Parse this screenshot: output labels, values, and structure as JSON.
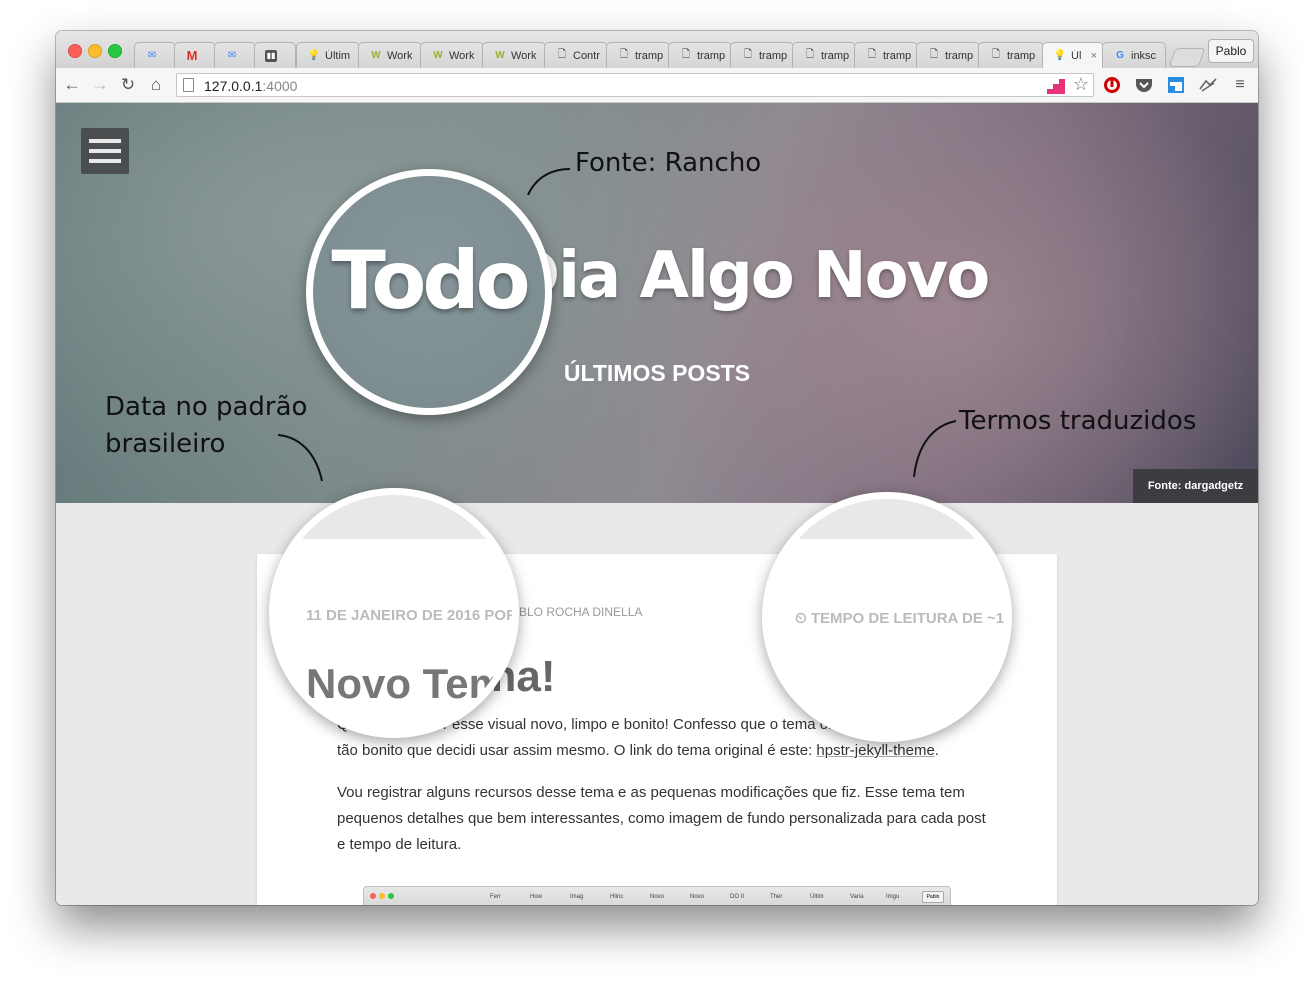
{
  "browser": {
    "tabs": [
      {
        "title": "",
        "icon": "inbox-icon"
      },
      {
        "title": "",
        "icon": "gmail-icon"
      },
      {
        "title": "",
        "icon": "inbox-icon"
      },
      {
        "title": "",
        "icon": "trello-icon"
      },
      {
        "title": "Últim",
        "icon": "bulb-icon"
      },
      {
        "title": "Work",
        "icon": "workflowy-icon"
      },
      {
        "title": "Work",
        "icon": "workflowy-icon"
      },
      {
        "title": "Work",
        "icon": "workflowy-icon"
      },
      {
        "title": "Contr",
        "icon": "page-icon"
      },
      {
        "title": "tramp",
        "icon": "page-icon"
      },
      {
        "title": "tramp",
        "icon": "page-icon"
      },
      {
        "title": "tramp",
        "icon": "page-icon"
      },
      {
        "title": "tramp",
        "icon": "page-icon"
      },
      {
        "title": "tramp",
        "icon": "page-icon"
      },
      {
        "title": "tramp",
        "icon": "page-icon"
      },
      {
        "title": "tramp",
        "icon": "page-icon"
      },
      {
        "title": "Úl",
        "icon": "bulb-icon",
        "active": true,
        "close": "×"
      },
      {
        "title": "inksc",
        "icon": "google-icon"
      }
    ],
    "profile_name": "Pablo",
    "url_host": "127.0.0.1",
    "url_port": ":4000"
  },
  "hero": {
    "title": "Todo Dia Algo Novo",
    "magnified_word": "Todo",
    "subtitle": "ÚLTIMOS POSTS",
    "credit": "Fonte: dargadgetz"
  },
  "annotations": {
    "font": "Fonte: Rancho",
    "date_line1": "Data no padrão",
    "date_line2": "brasileiro",
    "terms": "Termos traduzidos"
  },
  "post": {
    "date": "11 DE JANEIRO DE 2016 POR",
    "author": "BLO ROCHA DINELLA",
    "reading_time": "⏲ TEMPO DE LEITURA DE ~1",
    "title": "Novo Tema!",
    "title_magnified": "Novo Tem",
    "p1_start": "Quem está a ver esse visual novo, limpo e bonito! Confesso que o tema original que usei é",
    "p1_line2": "tão bonito que decidi usar assim mesmo. O link do tema original é este: ",
    "p1_link": "hpstr-jekyll-theme",
    "p1_end": ".",
    "p2": "Vou registrar alguns recursos desse tema e as pequenas modificações que fiz. Esse tema tem pequenos detalhes que bem interessantes, como imagem de fundo personalizada para cada post e tempo de leitura."
  },
  "embedded_screenshot": {
    "tabs": [
      "Ferr",
      "How",
      "Imag",
      "Hlinc",
      "Novo",
      "Novo",
      "DO II",
      "Ther",
      "Últim",
      "Varia",
      "Imgu"
    ],
    "profile_name": "Pablo"
  },
  "colors": {
    "hero_teal": "#6f8384",
    "hero_mauve": "#8e7684",
    "card_bg": "#ffffff",
    "credit_bg": "#3b3d40",
    "menu_bg": "#4a4e50"
  }
}
